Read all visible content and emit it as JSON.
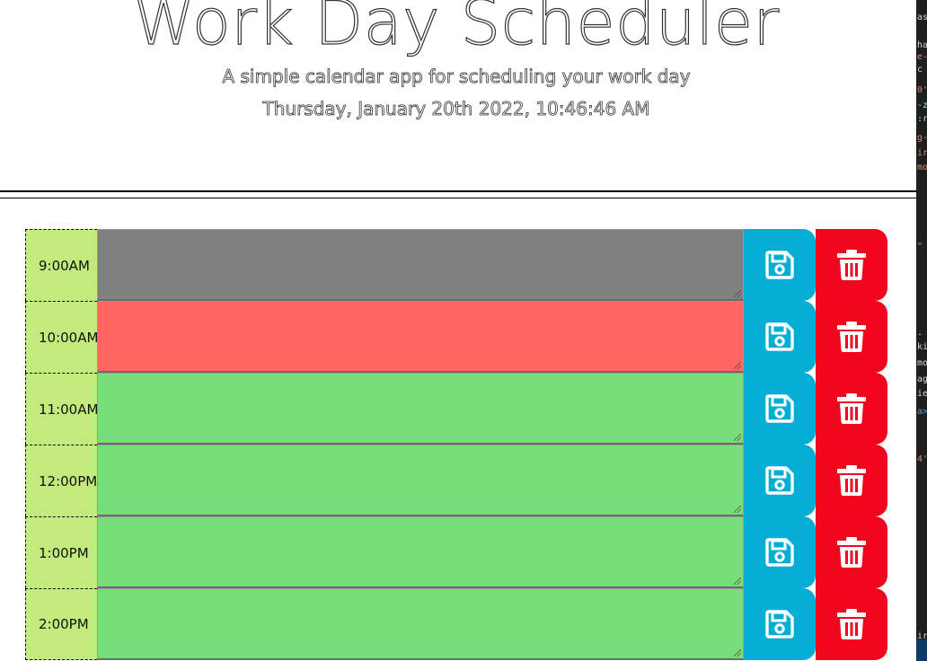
{
  "header": {
    "title": "Work Day Scheduler",
    "subtitle": "A simple calendar app for scheduling your work day",
    "current_day": "Thursday, January 20th 2022, 10:46:46 AM"
  },
  "time_blocks": [
    {
      "hour": "9:00AM",
      "text": "",
      "status": "past"
    },
    {
      "hour": "10:00AM",
      "text": "",
      "status": "present"
    },
    {
      "hour": "11:00AM",
      "text": "",
      "status": "future"
    },
    {
      "hour": "12:00PM",
      "text": "",
      "status": "future"
    },
    {
      "hour": "1:00PM",
      "text": "",
      "status": "future"
    },
    {
      "hour": "2:00PM",
      "text": "",
      "status": "future"
    }
  ],
  "icons": {
    "save": "floppy-disk-icon",
    "delete": "trash-icon"
  },
  "colors": {
    "hour_bg": "#c3ea7c",
    "past": "#808080",
    "present": "#ff6561",
    "future": "#77df79",
    "save_button": "#06aed5",
    "delete_button": "#f0071d"
  },
  "devtools_strip": [
    {
      "text": "as",
      "color": "#d4d4d4"
    },
    {
      "text": "ha",
      "color": "#d4d4d4"
    },
    {
      "text": "e-",
      "color": "#ce9178"
    },
    {
      "text": " c",
      "color": "#d4d4d4"
    },
    {
      "text": "0'",
      "color": "#ce9178"
    },
    {
      "text": "-z",
      "color": "#9cdcfe"
    },
    {
      "text": ":r",
      "color": "#9cdcfe"
    },
    {
      "text": "g-",
      "color": "#ce9178"
    },
    {
      "text": "ir",
      "color": "#ce9178"
    },
    {
      "text": "mo",
      "color": "#ce9178"
    },
    {
      "text": "\"",
      "color": "#ce9178"
    },
    {
      "text": ".",
      "color": "#d4d4d4"
    },
    {
      "text": "ki",
      "color": "#d4d4d4"
    },
    {
      "text": "mo",
      "color": "#d4d4d4"
    },
    {
      "text": "ag",
      "color": "#d4d4d4"
    },
    {
      "text": "ie",
      "color": "#d4d4d4"
    },
    {
      "text": "a>",
      "color": "#569cd6"
    },
    {
      "text": "4'",
      "color": "#ce9178"
    },
    {
      "text": "ir",
      "color": "#d4d4d4"
    }
  ]
}
